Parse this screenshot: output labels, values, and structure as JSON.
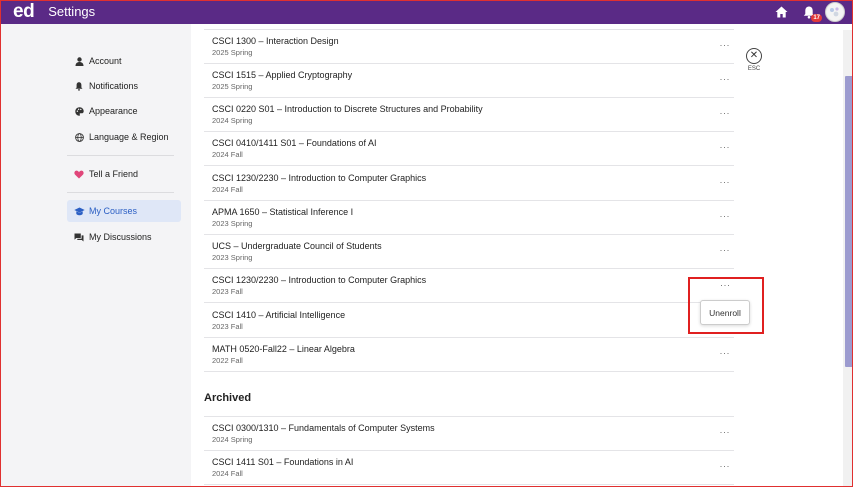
{
  "app": {
    "logo": "ed",
    "title": "Settings",
    "notification_count": "17"
  },
  "sidebar": {
    "items": [
      {
        "label": "Account",
        "icon": "person-icon"
      },
      {
        "label": "Notifications",
        "icon": "bell-icon"
      },
      {
        "label": "Appearance",
        "icon": "palette-icon"
      },
      {
        "label": "Language & Region",
        "icon": "globe-icon"
      },
      {
        "label": "Tell a Friend",
        "icon": "heart-icon"
      },
      {
        "label": "My Courses",
        "icon": "graduation-cap-icon",
        "active": true
      },
      {
        "label": "My Discussions",
        "icon": "chat-icon"
      }
    ]
  },
  "courses": [
    {
      "title": "CSCI 1300 – Interaction Design",
      "term": "2025 Spring"
    },
    {
      "title": "CSCI 1515 – Applied Cryptography",
      "term": "2025 Spring"
    },
    {
      "title": "CSCI 0220 S01 – Introduction to Discrete Structures and Probability",
      "term": "2024 Spring"
    },
    {
      "title": "CSCI 0410/1411 S01 – Foundations of AI",
      "term": "2024 Fall"
    },
    {
      "title": "CSCI 1230/2230 – Introduction to Computer Graphics",
      "term": "2024 Fall"
    },
    {
      "title": "APMA 1650 – Statistical Inference I",
      "term": "2023 Spring"
    },
    {
      "title": "UCS – Undergraduate Council of Students",
      "term": "2023 Spring"
    },
    {
      "title": "CSCI 1230/2230 – Introduction to Computer Graphics",
      "term": "2023 Fall"
    },
    {
      "title": "CSCI 1410 – Artificial Intelligence",
      "term": "2023 Fall"
    },
    {
      "title": "MATH 0520-Fall22 – Linear Algebra",
      "term": "2022 Fall"
    }
  ],
  "archived": {
    "title": "Archived",
    "courses": [
      {
        "title": "CSCI 0300/1310 – Fundamentals of Computer Systems",
        "term": "2024 Spring"
      },
      {
        "title": "CSCI 1411 S01 – Foundations in AI",
        "term": "2024 Fall"
      }
    ]
  },
  "more_label": "···",
  "popup": {
    "label": "Unenroll"
  },
  "esc": {
    "label": "ESC",
    "symbol": "✕"
  },
  "colors": {
    "topbar": "#5a2a86",
    "active_nav_bg": "#dfe7f7",
    "active_nav_text": "#2b5fc4",
    "highlight": "#e02020"
  }
}
